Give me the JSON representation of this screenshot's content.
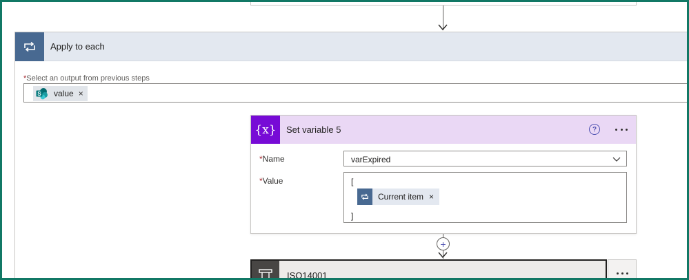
{
  "apply_each": {
    "title": "Apply to each",
    "select_label": "Select an output from previous steps",
    "required_marker": "*",
    "token": {
      "label": "value",
      "remove": "×",
      "icon": "sharepoint-icon"
    },
    "header_color": "#e3e8f0",
    "icon_color": "#486991"
  },
  "set_variable": {
    "title": "Set variable 5",
    "icon_glyph": "{x}",
    "help_glyph": "?",
    "header_color": "#ead8f5",
    "icon_color": "#770bd6",
    "name_label": "Name",
    "name_value": "varExpired",
    "value_label": "Value",
    "value_open": "[",
    "value_close": "]",
    "current_item": {
      "label": "Current item",
      "remove": "×"
    }
  },
  "add_step": {
    "glyph": "+"
  },
  "iso_card": {
    "title": "ISO14001"
  }
}
